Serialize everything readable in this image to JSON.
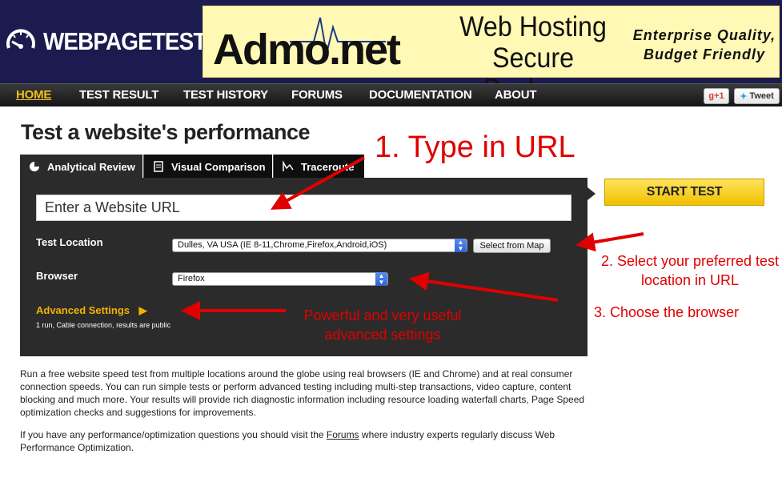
{
  "header": {
    "logo_text": "WEBPAGETEST",
    "logo_icon": "speedometer-icon"
  },
  "ad": {
    "brand": "Admo.net",
    "line1": "Web Hosting",
    "line2": "Secure Backups",
    "tag1": "Enterprise Quality,",
    "tag2": "Budget Friendly"
  },
  "nav": {
    "items": [
      "HOME",
      "TEST RESULT",
      "TEST HISTORY",
      "FORUMS",
      "DOCUMENTATION",
      "ABOUT"
    ],
    "gplus": "+1",
    "tweet": "Tweet"
  },
  "main": {
    "title": "Test a website's performance",
    "tabs": [
      "Analytical Review",
      "Visual Comparison",
      "Traceroute"
    ],
    "url_placeholder": "Enter a Website URL",
    "test_location_label": "Test Location",
    "test_location_value": "Dulles, VA USA (IE 8-11,Chrome,Firefox,Android,iOS)",
    "select_from_map": "Select from Map",
    "browser_label": "Browser",
    "browser_value": "Firefox",
    "advanced_settings": "Advanced Settings",
    "advanced_summary": "1 run, Cable connection, results are public",
    "start_test": "START TEST"
  },
  "description": {
    "paragraph1": "Run a free website speed test from multiple locations around the globe using real browsers (IE and Chrome) and at real consumer connection speeds. You can run simple tests or perform advanced testing including multi-step transactions, video capture, content blocking and much more. Your results will provide rich diagnostic information including resource loading waterfall charts, Page Speed optimization checks and suggestions for improvements.",
    "paragraph2_before": "If you have any performance/optimization questions you should visit the ",
    "paragraph2_link": "Forums",
    "paragraph2_after": " where industry experts regularly discuss Web Performance Optimization."
  },
  "annotations": {
    "step1": "1. Type in URL",
    "step2": "2. Select your preferred test location in URL",
    "step3": "3. Choose the browser",
    "advanced_note": "Powerful and very useful advanced settings"
  },
  "colors": {
    "header_bg": "#1b1b4f",
    "accent_yellow": "#f0c000",
    "panel_bg": "#2b2b2b",
    "annotation_red": "#e00000"
  }
}
